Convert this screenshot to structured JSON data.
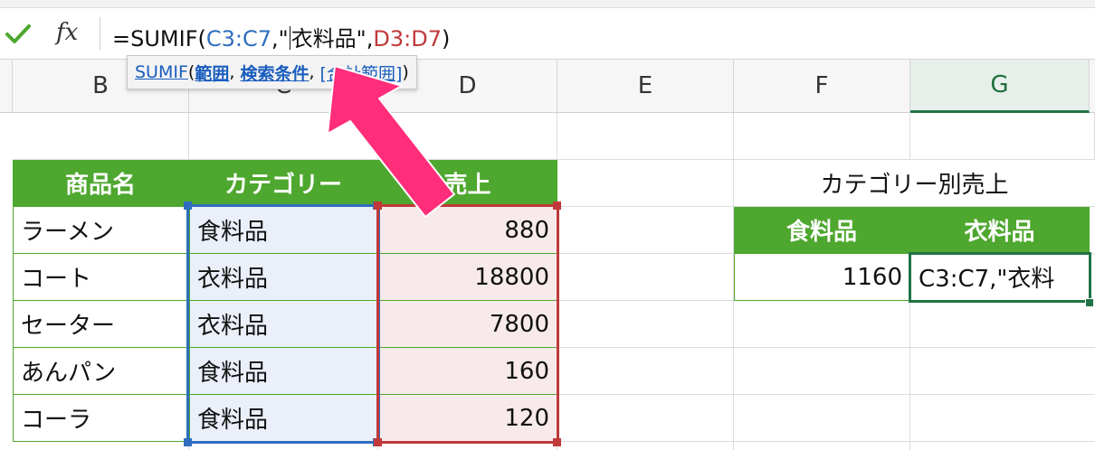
{
  "formula_bar": {
    "confirm_icon": "checkmark-icon",
    "fx_label": "fx",
    "formula_prefix": "=SUMIF(",
    "formula_range1": "C3:C7",
    "formula_mid1": ",\"",
    "formula_criteria": "衣料品\"",
    "formula_mid2": ",",
    "formula_range2": "D3:D7",
    "formula_suffix": ")"
  },
  "tooltip": {
    "function_name": "SUMIF",
    "open": "(",
    "arg1": "範囲",
    "sep1": ", ",
    "arg2": "検索条件",
    "sep2": ", ",
    "arg3": "[合計範囲]",
    "close": ")"
  },
  "columns": [
    "B",
    "C",
    "D",
    "E",
    "F",
    "G"
  ],
  "selected_column": "G",
  "table": {
    "headers": [
      "商品名",
      "カテゴリー",
      "売上"
    ],
    "rows": [
      {
        "name": "ラーメン",
        "category": "食料品",
        "sales": "880"
      },
      {
        "name": "コート",
        "category": "衣料品",
        "sales": "18800"
      },
      {
        "name": "セーター",
        "category": "衣料品",
        "sales": "7800"
      },
      {
        "name": "あんパン",
        "category": "食料品",
        "sales": "160"
      },
      {
        "name": "コーラ",
        "category": "食料品",
        "sales": "120"
      }
    ]
  },
  "summary": {
    "title": "カテゴリー別売上",
    "headers": [
      "食料品",
      "衣料品"
    ],
    "food_total": "1160",
    "editing_text": "C3:C7,\"衣料"
  },
  "colors": {
    "header_green": "#4ea72e",
    "range1_blue": "#2f6ebe",
    "range2_red": "#c0393b",
    "annotation_arrow": "#ff2d7a",
    "active_cell": "#217346"
  }
}
